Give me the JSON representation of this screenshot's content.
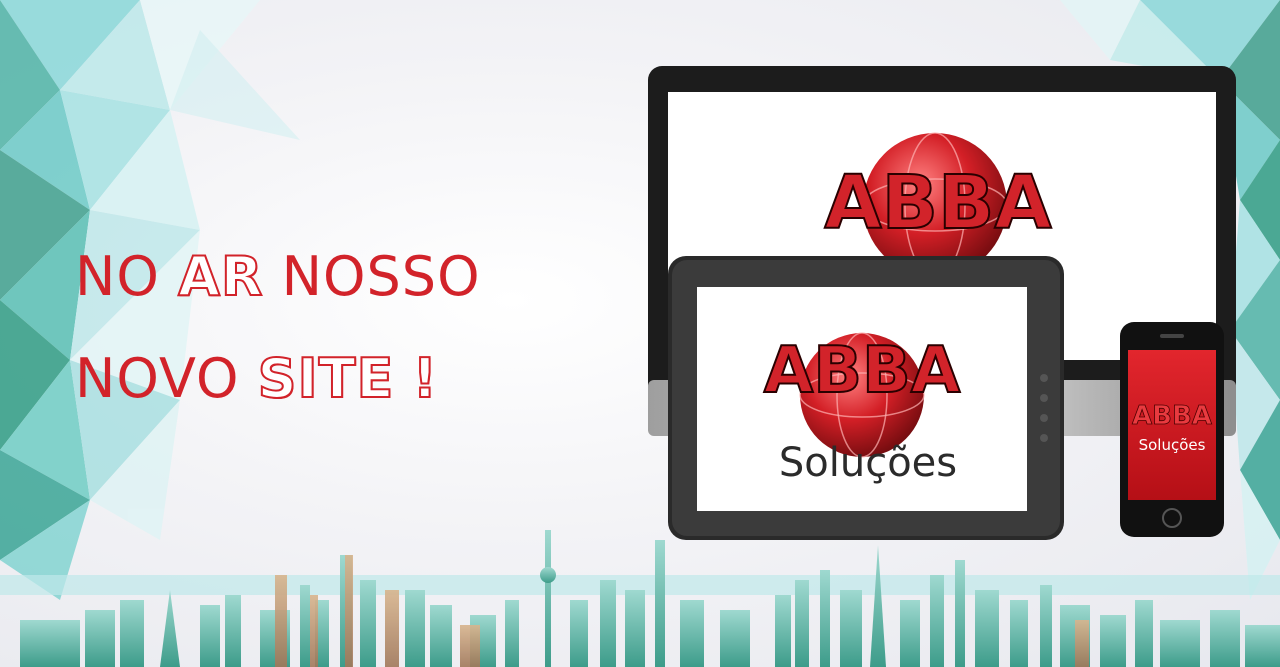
{
  "headline": {
    "line1": {
      "w1": "NO",
      "w2": "AR",
      "w3": "NOSSO"
    },
    "line2": {
      "w1": "NOVO",
      "w2": "SITE",
      "w3": "!"
    }
  },
  "brand": {
    "name": "ABBA",
    "subtitle": "Soluções"
  },
  "colors": {
    "accent_red": "#d2232a",
    "device_frame": "#1c1c1c",
    "skyline_teal": "#3aa596"
  },
  "icons": [
    "desktop-monitor-icon",
    "tablet-icon",
    "smartphone-icon",
    "globe-icon",
    "city-skyline-icon"
  ]
}
